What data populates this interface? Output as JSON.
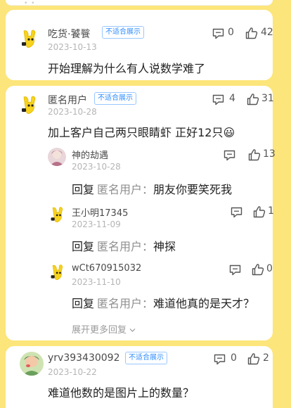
{
  "comments": [
    {
      "name": "吃货·饕餮",
      "badge": "不适合展示",
      "date": "2023-10-13",
      "content": "开始理解为什么有人说数学难了",
      "comment_count": "0",
      "like_count": "42"
    },
    {
      "name": "匿名用户",
      "badge": "不适合展示",
      "date": "2023-10-28",
      "content": "加上客户自己两只眼睛虾 正好12只😃",
      "comment_count": "4",
      "like_count": "31",
      "replies": [
        {
          "name": "神的劫遇",
          "date": "2023-10-28",
          "reply_label": "回复",
          "reply_target": "匿名用户：",
          "text": "朋友你要笑死我",
          "like_count": "13"
        },
        {
          "name": "王小明17345",
          "date": "2023-11-09",
          "reply_label": "回复",
          "reply_target": "匿名用户：",
          "text": "神探",
          "like_count": "1"
        },
        {
          "name": "wCt670915032",
          "date": "2023-11-10",
          "reply_label": "回复",
          "reply_target": "匿名用户：",
          "text": "难道他真的是天才？",
          "like_count": "0"
        }
      ],
      "more_replies": "展开更多回复"
    },
    {
      "name": "yrv393430092",
      "badge": "不适合展示",
      "date": "2023-10-22",
      "content": "难道他数的是图片上的数量？",
      "comment_count": "0",
      "like_count": "2"
    }
  ],
  "colors": {
    "background": "#FCE57A",
    "badge_blue": "#2F8CFF",
    "text_dark": "#222222",
    "text_gray": "#B5B5B5"
  },
  "icons": [
    "mascot-avatar-icon",
    "comment-icon",
    "thumbs-up-icon",
    "chevron-down-icon"
  ]
}
